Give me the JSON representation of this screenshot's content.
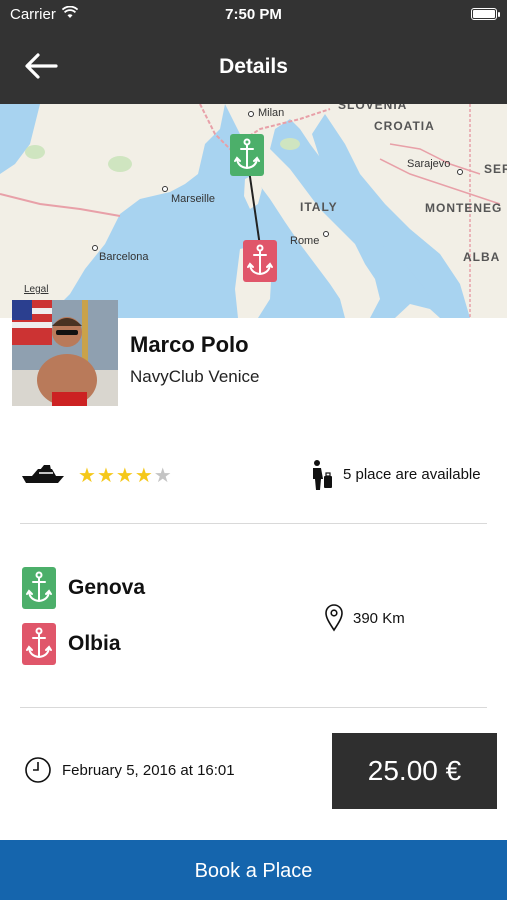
{
  "status_bar": {
    "carrier": "Carrier",
    "time": "7:50 PM",
    "battery_level": 1.0
  },
  "nav": {
    "title": "Details",
    "back_icon": "arrow-left-icon"
  },
  "map": {
    "labels": {
      "slovenia": "SLOVENIA",
      "croatia": "CROATIA",
      "milan": "Milan",
      "sarajevo": "Sarajevo",
      "ser": "SER",
      "marseille": "Marseille",
      "italy": "ITALY",
      "montenegro": "MONTENEG",
      "rome": "Rome",
      "barcelona": "Barcelona",
      "albania": "ALBA"
    },
    "legal": "Legal",
    "start_pin_icon": "anchor-icon",
    "end_pin_icon": "anchor-icon"
  },
  "skipper": {
    "name": "Marco Polo",
    "club": "NavyClub Venice"
  },
  "info": {
    "boat_icon": "boat-icon",
    "rating": 4,
    "rating_max": 5,
    "person_icon": "person-luggage-icon",
    "availability": "5 place are available"
  },
  "route": {
    "from": "Genova",
    "to": "Olbia",
    "distance": "390 Km",
    "distance_icon": "location-pin-icon"
  },
  "trip": {
    "clock_icon": "clock-icon",
    "date": "February 5, 2016 at 16:01",
    "price": "25.00 €"
  },
  "colors": {
    "header": "#333333",
    "start_pin": "#4caf6a",
    "end_pin": "#e0566a",
    "star": "#f5c81a",
    "book_button": "#1565ad",
    "price_box": "#2f2f2f"
  },
  "book_button": "Book a Place"
}
